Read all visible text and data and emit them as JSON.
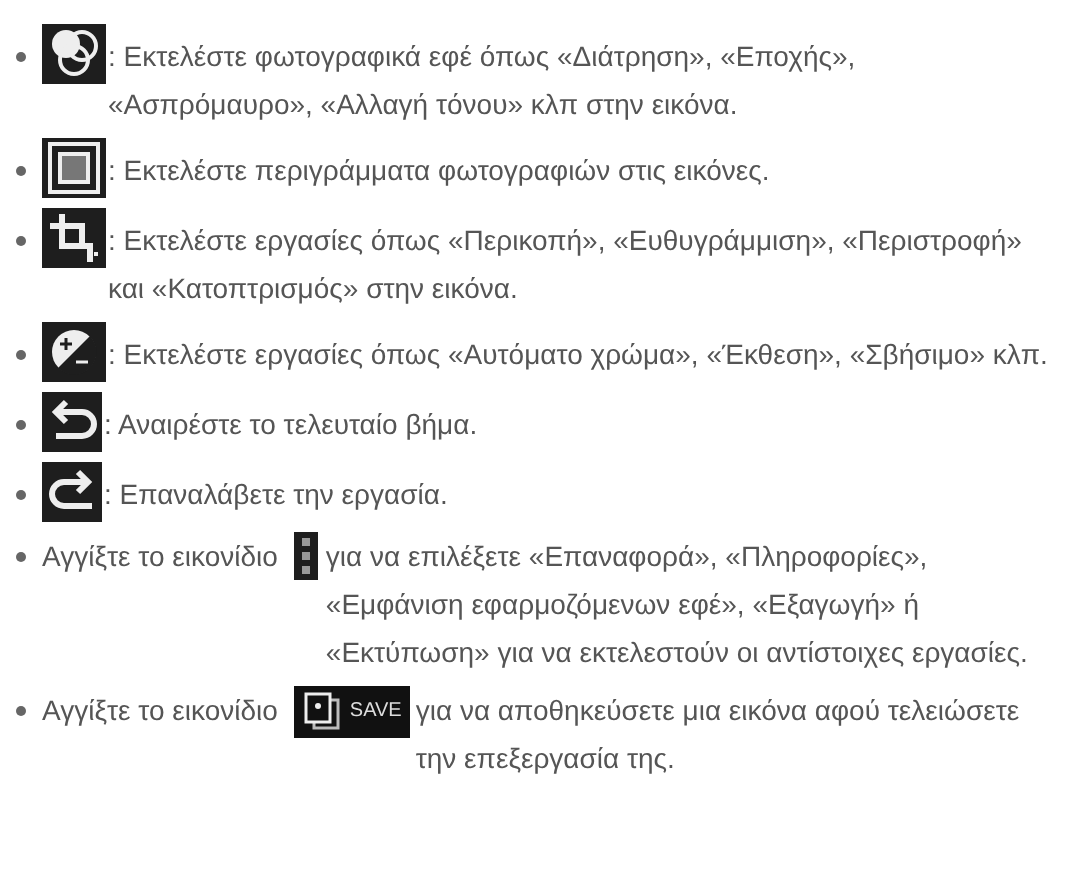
{
  "items": [
    {
      "kind": "icon-lead",
      "text": ": Εκτελέστε φωτογραφικά εφέ όπως «Διάτρηση», «Εποχής», «Ασπρόμαυρο», «Αλλαγή τόνου» κλπ στην εικόνα."
    },
    {
      "kind": "icon-lead",
      "text": ": Εκτελέστε περιγράμματα φωτογραφιών στις εικόνες."
    },
    {
      "kind": "icon-lead",
      "text": ": Εκτελέστε εργασίες όπως «Περικοπή», «Ευθυγράμμιση», «Περιστροφή» και «Κατοπτρισμός» στην εικόνα."
    },
    {
      "kind": "icon-lead",
      "text": ": Εκτελέστε εργασίες όπως «Αυτόματο χρώμα», «Έκθεση», «Σβήσιμο» κλπ."
    },
    {
      "kind": "icon-lead",
      "text": ": Αναιρέστε το τελευταίο βήμα."
    },
    {
      "kind": "icon-lead",
      "text": ": Επαναλάβετε την εργασία."
    },
    {
      "kind": "inline",
      "before": "Αγγίξτε το εικονίδιο",
      "after": "για να επιλέξετε «Επαναφορά», «Πληροφορίες», «Εμφάνιση εφαρμοζόμενων εφέ», «Εξαγωγή» ή «Εκτύπωση» για να εκτελεστούν οι αντίστοιχες εργασίες."
    },
    {
      "kind": "inline-badge",
      "icon_label": "SAVE",
      "before": "Αγγίξτε το εικονίδιο",
      "after": "για να αποθηκεύσετε μια εικόνα αφού τελειώσετε την επεξεργασία της."
    }
  ]
}
